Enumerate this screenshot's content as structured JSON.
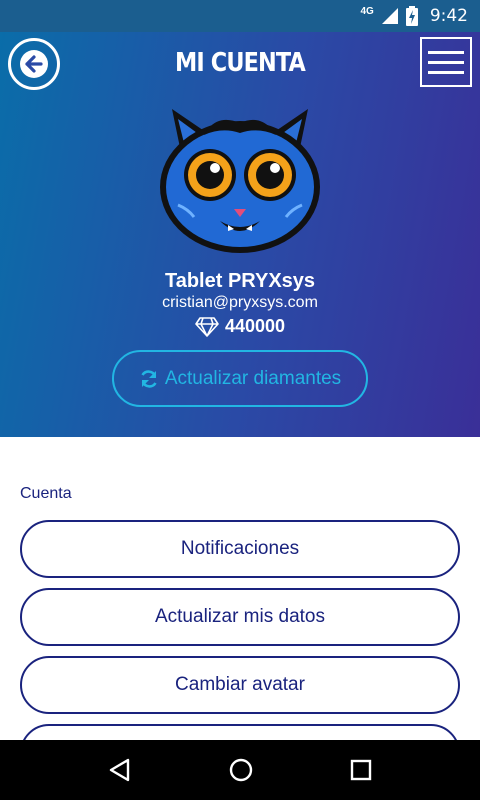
{
  "status_bar": {
    "network": "4G",
    "time": "9:42"
  },
  "header": {
    "title": "MI CUENTA"
  },
  "profile": {
    "name": "Tablet PRYXsys",
    "email": "cristian@pryxsys.com",
    "diamonds": "440000",
    "refresh_label": "Actualizar diamantes"
  },
  "section": {
    "label": "Cuenta",
    "options": [
      {
        "label": "Notificaciones"
      },
      {
        "label": "Actualizar mis datos"
      },
      {
        "label": "Cambiar avatar"
      }
    ]
  },
  "colors": {
    "accent": "#22b6e3",
    "primary_dark": "#1a237e",
    "gradient_start": "#0a6da9",
    "gradient_end": "#3a2f98"
  },
  "icons": [
    "back-arrow-icon",
    "menu-icon",
    "diamond-icon",
    "refresh-icon",
    "nav-back-icon",
    "nav-home-icon",
    "nav-recents-icon"
  ]
}
